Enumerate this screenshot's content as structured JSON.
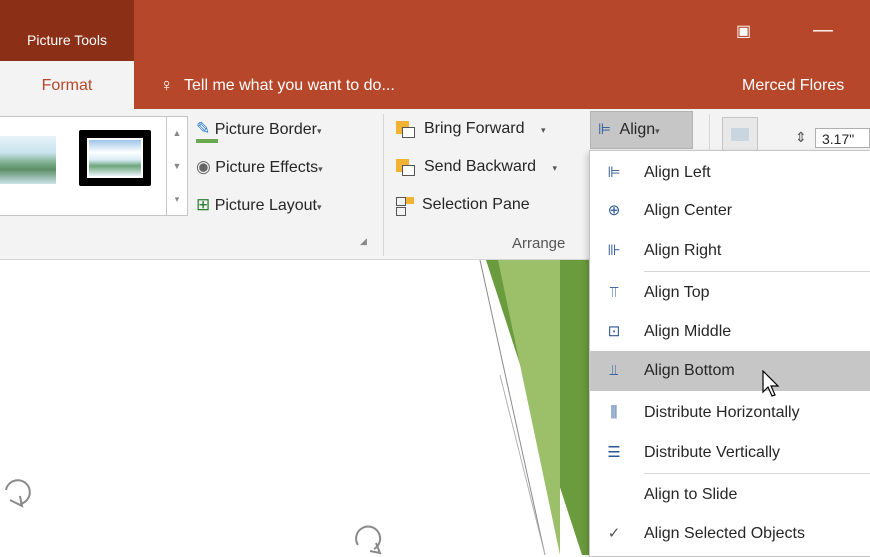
{
  "titlebar": {
    "context_tab": "Picture Tools",
    "restore_icon": "▣",
    "minimize_icon": "—"
  },
  "tabs": {
    "format": "Format",
    "tell_me_icon": "♀",
    "tell_me": "Tell me what you want to do...",
    "user": "Merced Flores"
  },
  "ribbon": {
    "picture_styles": {
      "commands": [
        {
          "icon": "✎",
          "label": "Picture Border"
        },
        {
          "icon": "◉",
          "label": "Picture Effects"
        },
        {
          "icon": "⊞",
          "label": "Picture Layout"
        }
      ],
      "dropdown_glyph": "▾",
      "launcher_glyph": "◢"
    },
    "arrange": {
      "bring_forward": "Bring Forward",
      "send_backward": "Send Backward",
      "selection_pane": "Selection Pane",
      "group_label": "Arrange",
      "align": "Align"
    },
    "size": {
      "height_value": "3.17\""
    }
  },
  "align_menu": {
    "items": [
      {
        "icon": "⊫",
        "label": "Align Left"
      },
      {
        "icon": "⊕",
        "label": "Align Center"
      },
      {
        "icon": "⊪",
        "label": "Align Right"
      },
      {
        "icon": "⫪",
        "label": "Align Top"
      },
      {
        "icon": "⊡",
        "label": "Align Middle"
      },
      {
        "icon": "⫫",
        "label": "Align Bottom"
      },
      {
        "icon": "⫼",
        "label": "Distribute Horizontally"
      },
      {
        "icon": "☰",
        "label": "Distribute Vertically"
      },
      {
        "icon": "",
        "label": "Align to Slide"
      },
      {
        "icon": "✓",
        "label": "Align Selected Objects"
      }
    ],
    "highlighted": "Align Bottom"
  },
  "colors": {
    "ribbon_accent": "#b7472a",
    "context_tab": "#8c2f17",
    "shape_green": "#6a9b3d"
  }
}
